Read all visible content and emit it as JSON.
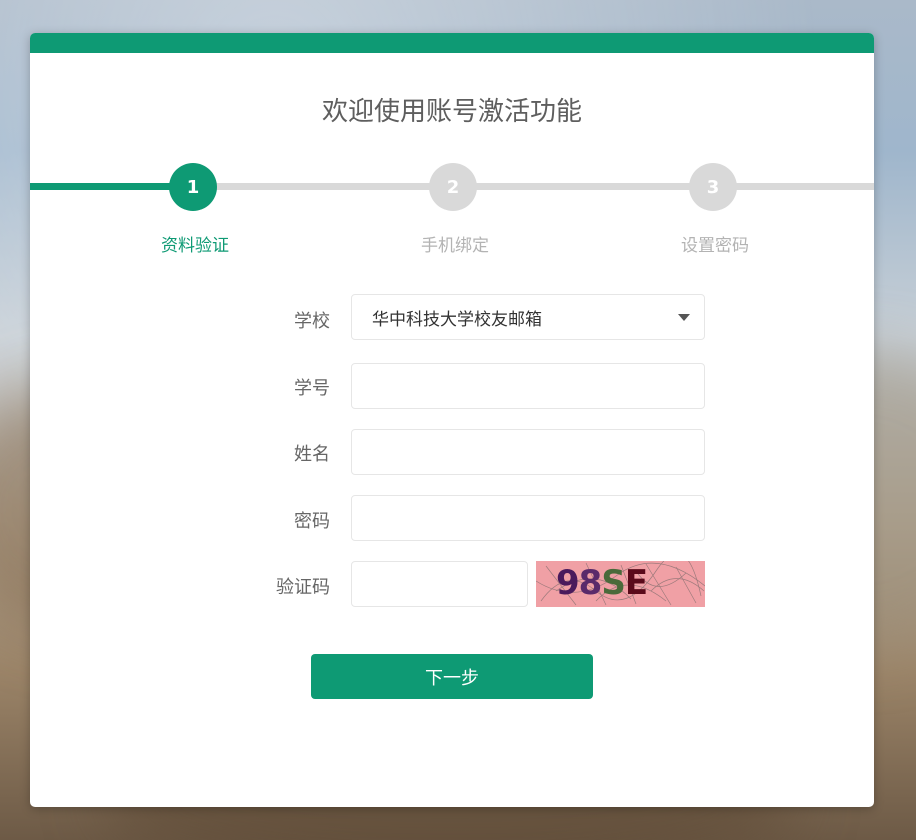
{
  "header": {
    "title": "欢迎使用账号激活功能"
  },
  "steps": [
    {
      "number": "1",
      "label": "资料验证",
      "state": "active"
    },
    {
      "number": "2",
      "label": "手机绑定",
      "state": "inactive"
    },
    {
      "number": "3",
      "label": "设置密码",
      "state": "inactive"
    }
  ],
  "form": {
    "school": {
      "label": "学校",
      "value": "华中科技大学校友邮箱"
    },
    "student_id": {
      "label": "学号",
      "value": "",
      "placeholder": ""
    },
    "name": {
      "label": "姓名",
      "value": "",
      "placeholder": ""
    },
    "password": {
      "label": "密码",
      "value": "",
      "placeholder": ""
    },
    "captcha": {
      "label": "验证码",
      "value": "",
      "placeholder": "",
      "image_text": "98SE",
      "image_colors": [
        "#4a1a5c",
        "#5a2a6a",
        "#4a6a3a",
        "#5a0a1a"
      ]
    },
    "next_button": "下一步"
  },
  "colors": {
    "accent": "#0e9a74",
    "inactive": "#d9d9d9",
    "captcha_bg": "#f0a0a5"
  }
}
